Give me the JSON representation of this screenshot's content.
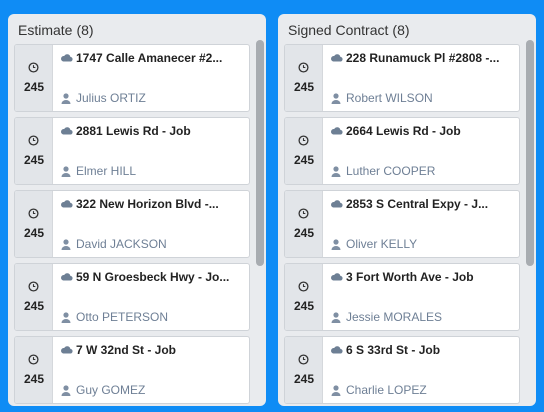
{
  "columns": [
    {
      "name": "Estimate",
      "count": "(8)",
      "cards": [
        {
          "days": "245",
          "title": "1747 Calle Amanecer #2...",
          "contact": "Julius ORTIZ"
        },
        {
          "days": "245",
          "title": "2881 Lewis Rd - Job",
          "contact": "Elmer HILL"
        },
        {
          "days": "245",
          "title": "322 New Horizon Blvd -...",
          "contact": "David JACKSON"
        },
        {
          "days": "245",
          "title": "59 N Groesbeck Hwy - Jo...",
          "contact": "Otto PETERSON"
        },
        {
          "days": "245",
          "title": "7 W 32nd St - Job",
          "contact": "Guy GOMEZ"
        }
      ]
    },
    {
      "name": "Signed Contract",
      "count": "(8)",
      "cards": [
        {
          "days": "245",
          "title": "228 Runamuck Pl #2808 -...",
          "contact": "Robert WILSON"
        },
        {
          "days": "245",
          "title": "2664 Lewis Rd - Job",
          "contact": "Luther COOPER"
        },
        {
          "days": "245",
          "title": "2853 S Central Expy - J...",
          "contact": "Oliver KELLY"
        },
        {
          "days": "245",
          "title": "3 Fort Worth Ave - Job",
          "contact": "Jessie MORALES"
        },
        {
          "days": "245",
          "title": "6 S 33rd St - Job",
          "contact": "Charlie LOPEZ"
        }
      ]
    }
  ],
  "icons": {
    "card_side": "clock-icon",
    "card_title": "cloud-icon",
    "card_contact": "person-icon"
  },
  "colors": {
    "background": "#0f8cf5",
    "column": "#e9ebee",
    "contact_text": "#6e7f95",
    "scroll_thumb": "#a8acb1"
  }
}
